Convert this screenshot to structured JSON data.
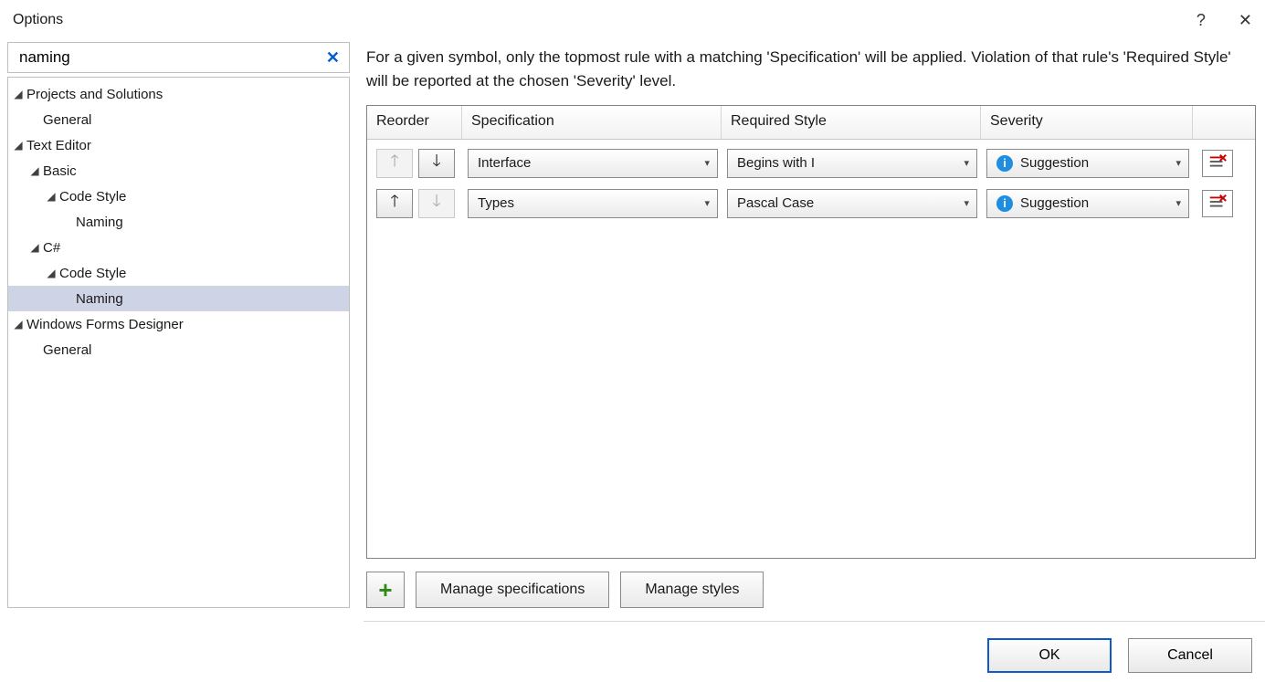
{
  "window": {
    "title": "Options"
  },
  "search": {
    "value": "naming",
    "clear_icon": "x-icon"
  },
  "tree": [
    {
      "level": 0,
      "expand": true,
      "label": "Projects and Solutions",
      "selected": false
    },
    {
      "level": 1,
      "expand": false,
      "label": "General",
      "selected": false
    },
    {
      "level": 0,
      "expand": true,
      "label": "Text Editor",
      "selected": false
    },
    {
      "level": 1,
      "expand": true,
      "label": "Basic",
      "selected": false
    },
    {
      "level": 2,
      "expand": true,
      "label": "Code Style",
      "selected": false
    },
    {
      "level": 3,
      "expand": false,
      "label": "Naming",
      "selected": false
    },
    {
      "level": 1,
      "expand": true,
      "label": "C#",
      "selected": false
    },
    {
      "level": 2,
      "expand": true,
      "label": "Code Style",
      "selected": false
    },
    {
      "level": 3,
      "expand": false,
      "label": "Naming",
      "selected": true
    },
    {
      "level": 0,
      "expand": true,
      "label": "Windows Forms Designer",
      "selected": false
    },
    {
      "level": 1,
      "expand": false,
      "label": "General",
      "selected": false
    }
  ],
  "main": {
    "description": "For a given symbol, only the topmost rule with a matching 'Specification' will be applied. Violation of that rule's 'Required Style' will be reported at the chosen 'Severity' level.",
    "columns": {
      "reorder": "Reorder",
      "spec": "Specification",
      "style": "Required Style",
      "severity": "Severity"
    },
    "rows": [
      {
        "up_enabled": false,
        "down_enabled": true,
        "spec": "Interface",
        "style": "Begins with I",
        "severity": "Suggestion",
        "severity_icon": "info-icon"
      },
      {
        "up_enabled": true,
        "down_enabled": false,
        "spec": "Types",
        "style": "Pascal Case",
        "severity": "Suggestion",
        "severity_icon": "info-icon"
      }
    ],
    "add_icon": "plus-icon",
    "manage_spec_label": "Manage specifications",
    "manage_styles_label": "Manage styles"
  },
  "dialog": {
    "ok": "OK",
    "cancel": "Cancel"
  }
}
